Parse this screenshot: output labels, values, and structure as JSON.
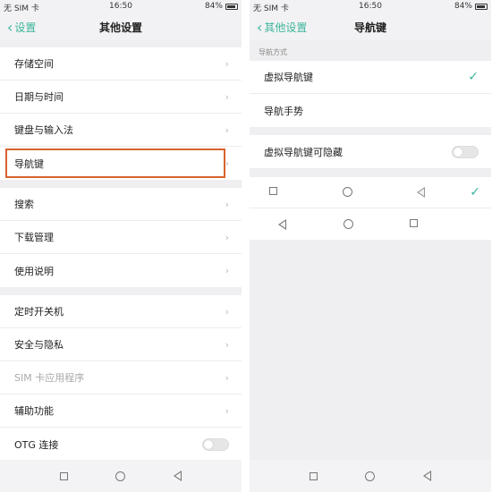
{
  "status": {
    "carrier": "无 SIM 卡",
    "time": "16:50",
    "battery": "84%"
  },
  "left": {
    "back_label": "设置",
    "title": "其他设置",
    "groups": [
      [
        "存储空间",
        "日期与时间",
        "键盘与输入法",
        "导航键"
      ],
      [
        "搜索",
        "下载管理",
        "使用说明"
      ],
      [
        "定时开关机",
        "安全与隐私",
        "SIM 卡应用程序",
        "辅助功能",
        "OTG 连接"
      ]
    ]
  },
  "right": {
    "back_label": "其他设置",
    "title": "导航键",
    "section_label": "导航方式",
    "nav_options": [
      "虚拟导航键",
      "导航手势"
    ],
    "hide_label": "虚拟导航键可隐藏"
  },
  "colors": {
    "accent": "#3cb59b",
    "highlight": "#d9622e"
  },
  "icons": {
    "square": "square-icon",
    "circle": "circle-icon",
    "back": "back-triangle-icon",
    "check": "checkmark-icon"
  }
}
